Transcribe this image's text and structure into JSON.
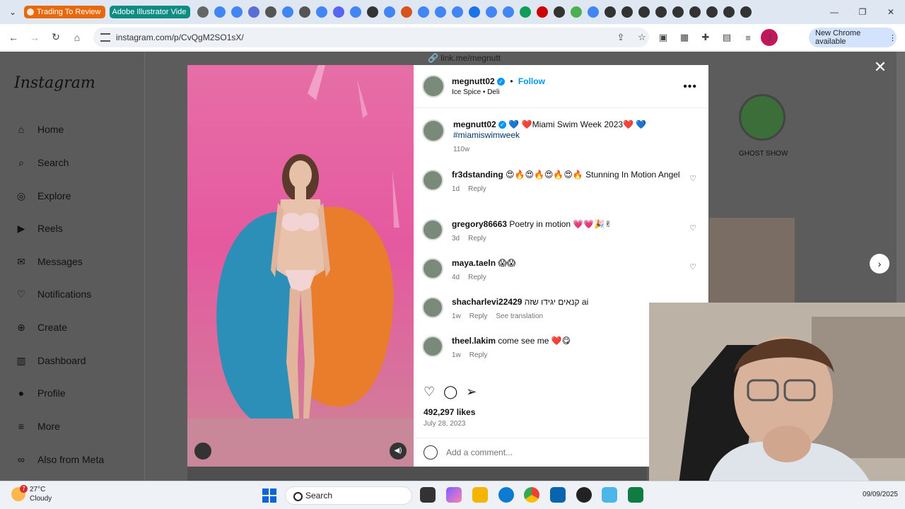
{
  "browser": {
    "tabs": [
      {
        "label": "Trading To Review",
        "color": "#e8690b"
      },
      {
        "label": "Adobe Illustrator Vide",
        "color": "#0d8c84"
      }
    ],
    "favicon_tabs": [
      "#666",
      "#4285f4",
      "#4285f4",
      "#5a6fd6",
      "#555",
      "#4285f4",
      "#555",
      "#4285f4",
      "#5865f2",
      "#4285f4",
      "#333",
      "#4285f4",
      "#d9531e",
      "#4285f4",
      "#4285f4",
      "#4285f4",
      "#1a73e8",
      "#4285f4",
      "#4285f4",
      "#0f9d58",
      "#cc0000",
      "#333",
      "#4caf50",
      "#4285f4",
      "#333",
      "#333",
      "#333",
      "#333",
      "#333",
      "#333",
      "#333",
      "#333",
      "#333"
    ],
    "url": "instagram.com/p/CvQgM2SO1sX/",
    "new_chrome": "New Chrome available",
    "profile_initial": "J"
  },
  "instagram": {
    "logo": "Instagram",
    "nav": [
      "Home",
      "Search",
      "Explore",
      "Reels",
      "Messages",
      "Notifications",
      "Create",
      "Dashboard",
      "Profile",
      "More",
      "Also from Meta"
    ],
    "link_banner": "link.me/megnutt",
    "story_label": "GHOST SHOW",
    "post": {
      "username": "megnutt02",
      "follow": "Follow",
      "location": "Ice Spice • Deli",
      "caption_user": "megnutt02",
      "caption": "💙 ❤️Miami Swim Week 2023❤️ 💙",
      "hashtag": "#miamiswimweek",
      "caption_age": "110w",
      "likes": "492,297 likes",
      "date": "July 28, 2023",
      "add_comment": "Add a comment..."
    },
    "comments": [
      {
        "user": "fr3dstanding",
        "text": "😍🔥😍🔥😍🔥😍🔥 Stunning In Motion Angel",
        "age": "1d",
        "reply": "Reply",
        "extra": "",
        "liked": true
      },
      {
        "user": "gregory86663",
        "text": "Poetry in motion 💗💗🎉✌",
        "age": "3d",
        "reply": "Reply",
        "extra": "",
        "liked": true
      },
      {
        "user": "maya.taeln",
        "text": "😱😱",
        "age": "4d",
        "reply": "Reply",
        "extra": "",
        "liked": true
      },
      {
        "user": "shacharlevi22429",
        "text": "קנאים יגידו שזה ai",
        "age": "1w",
        "reply": "Reply",
        "extra": "See translation",
        "liked": false
      },
      {
        "user": "theel.lakim",
        "text": "come see me ❤️😋",
        "age": "1w",
        "reply": "Reply",
        "extra": "",
        "liked": false
      }
    ]
  },
  "taskbar": {
    "temp": "27°C",
    "weather": "Cloudy",
    "weather_badge": "7",
    "search": "Search",
    "date": "09/09/2025"
  }
}
